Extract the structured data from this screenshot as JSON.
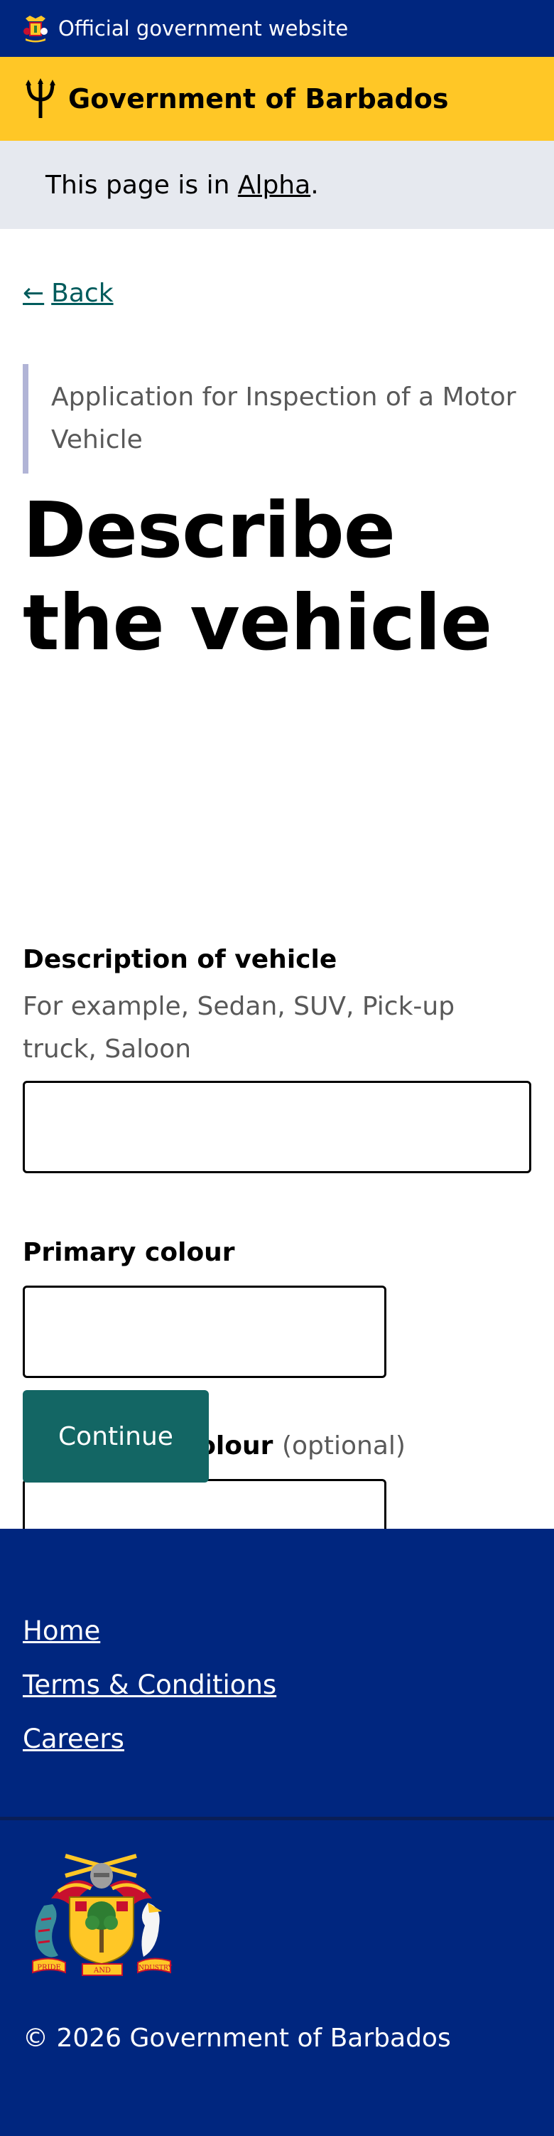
{
  "official_banner": {
    "text": "Official government website",
    "icon": "crest-icon"
  },
  "header": {
    "title": "Government of Barbados",
    "icon": "trident-icon"
  },
  "phase_banner": {
    "prefix": "This page is in ",
    "link": "Alpha",
    "suffix": "."
  },
  "back_link": {
    "arrow": "←",
    "label": "Back"
  },
  "form": {
    "caption": "Application for Inspection of a Motor Vehicle",
    "title": "Describe the vehicle",
    "fields": [
      {
        "label": "Description of vehicle",
        "hint": "For example, Sedan, SUV, Pick-up truck, Saloon",
        "value": ""
      },
      {
        "label": "Primary colour",
        "value": ""
      },
      {
        "label": "Secondary colour",
        "optional": "(optional)",
        "value": ""
      }
    ],
    "submit_label": "Continue"
  },
  "footer": {
    "links": [
      "Home",
      "Terms & Conditions",
      "Careers"
    ],
    "copyright": "© 2026 Government of Barbados",
    "logo_text": [
      "PRIDE",
      "AND",
      "INDUSTRY"
    ]
  },
  "colors": {
    "primary_blue": "#00267f",
    "header_yellow": "#ffc726",
    "phase_bg": "#e6e9ef",
    "button_teal": "#136664",
    "link_teal": "#005b5c"
  }
}
